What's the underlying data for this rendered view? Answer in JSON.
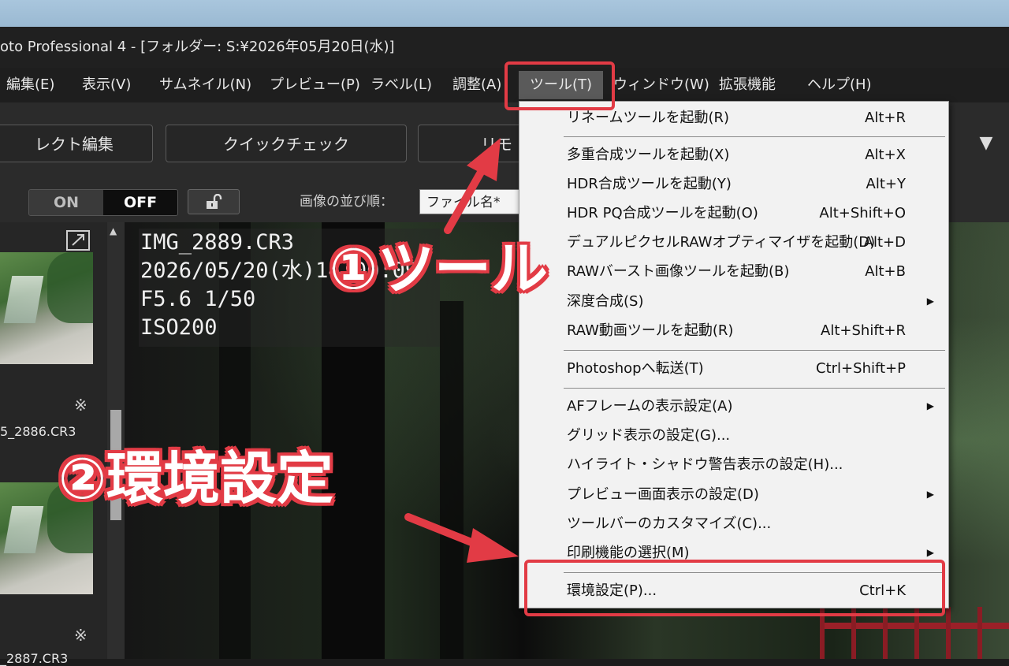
{
  "window": {
    "title": "oto Professional 4 - [フォルダー: S:¥2026年05月20日(水)]"
  },
  "menubar": {
    "items": [
      "編集(E)",
      "表示(V)",
      "サムネイル(N)",
      "プレビュー(P)",
      "ラベル(L)",
      "調整(A)",
      "ツール(T)",
      "ウィンドウ(W)",
      "拡張機能",
      "ヘルプ(H)"
    ]
  },
  "toolbar": {
    "buttons": [
      "レクト編集",
      "クイックチェック",
      "リモ"
    ],
    "on_label": "ON",
    "off_label": "OFF",
    "sort_label": "画像の並び順：",
    "sort_value": "ファイル名*"
  },
  "thumbnails": [
    {
      "filename": "5_2886.CR3",
      "mark": "※"
    },
    {
      "filename": "_2887.CR3",
      "mark": "※"
    }
  ],
  "preview": {
    "info_lines": [
      "IMG_2889.CR3",
      "2026/05/20(水)14:00:09",
      "F5.6 1/50",
      "ISO200"
    ]
  },
  "tools_menu": {
    "items": [
      {
        "label": "リネームツールを起動(R)",
        "shortcut": "Alt+R"
      },
      {
        "label": "多重合成ツールを起動(X)",
        "shortcut": "Alt+X"
      },
      {
        "label": "HDR合成ツールを起動(Y)",
        "shortcut": "Alt+Y"
      },
      {
        "label": "HDR PQ合成ツールを起動(O)",
        "shortcut": "Alt+Shift+O"
      },
      {
        "label": "デュアルピクセルRAWオプティマイザを起動(D)",
        "shortcut": "Alt+D"
      },
      {
        "label": "RAWバースト画像ツールを起動(B)",
        "shortcut": "Alt+B"
      },
      {
        "label": "深度合成(S)",
        "shortcut": ""
      },
      {
        "label": "RAW動画ツールを起動(R)",
        "shortcut": "Alt+Shift+R"
      },
      {
        "label": "Photoshopへ転送(T)",
        "shortcut": "Ctrl+Shift+P"
      },
      {
        "label": "AFフレームの表示設定(A)",
        "shortcut": ""
      },
      {
        "label": "グリッド表示の設定(G)...",
        "shortcut": ""
      },
      {
        "label": "ハイライト・シャドウ警告表示の設定(H)...",
        "shortcut": ""
      },
      {
        "label": "プレビュー画面表示の設定(D)",
        "shortcut": ""
      },
      {
        "label": "ツールバーのカスタマイズ(C)...",
        "shortcut": ""
      },
      {
        "label": "印刷機能の選択(M)",
        "shortcut": ""
      },
      {
        "label": "環境設定(P)...",
        "shortcut": "Ctrl+K"
      }
    ]
  },
  "annotations": {
    "step1": "①ツール",
    "step2": "②環境設定"
  },
  "colors": {
    "annotation_red": "#e23b45",
    "menu_bg": "#f2f2f2",
    "app_bg": "#2b2b2b"
  }
}
